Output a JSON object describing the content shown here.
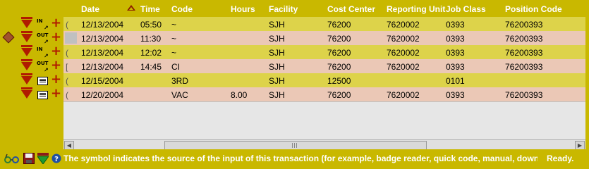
{
  "columns": {
    "date": "Date",
    "time": "Time",
    "code": "Code",
    "hours": "Hours",
    "facility": "Facility",
    "cost_center": "Cost Center",
    "reporting_unit": "Reporting Unit",
    "job_class": "Job Class",
    "position_code": "Position Code"
  },
  "rows": [
    {
      "source_icon": "in-punch-icon",
      "source_label": "IN",
      "prefix": "(",
      "date": "12/13/2004",
      "time": "05:50",
      "code": "~",
      "hours": "",
      "facility": "SJH",
      "cost_center": "76200",
      "reporting_unit": "7620002",
      "job_class": "0393",
      "position_code": "76200393",
      "color": "#ddd34a"
    },
    {
      "source_icon": "out-punch-icon",
      "source_label": "OUT",
      "prefix": "",
      "date": "12/13/2004",
      "time": "11:30",
      "code": "~",
      "hours": "",
      "facility": "SJH",
      "cost_center": "76200",
      "reporting_unit": "7620002",
      "job_class": "0393",
      "position_code": "76200393",
      "color": "#ebc8b6",
      "selected": true
    },
    {
      "source_icon": "in-punch-icon",
      "source_label": "IN",
      "prefix": "(",
      "date": "12/13/2004",
      "time": "12:02",
      "code": "~",
      "hours": "",
      "facility": "SJH",
      "cost_center": "76200",
      "reporting_unit": "7620002",
      "job_class": "0393",
      "position_code": "76200393",
      "color": "#ddd34a"
    },
    {
      "source_icon": "out-punch-icon",
      "source_label": "OUT",
      "prefix": "[",
      "date": "12/13/2004",
      "time": "14:45",
      "code": "CI",
      "hours": "",
      "facility": "SJH",
      "cost_center": "76200",
      "reporting_unit": "7620002",
      "job_class": "0393",
      "position_code": "76200393",
      "color": "#ebc8b6"
    },
    {
      "source_icon": "keyboard-icon",
      "source_label": "",
      "prefix": "(",
      "date": "12/15/2004",
      "time": "",
      "code": "3RD",
      "hours": "",
      "facility": "SJH",
      "cost_center": "12500",
      "reporting_unit": "",
      "job_class": "0101",
      "position_code": "",
      "color": "#ddd34a"
    },
    {
      "source_icon": "calendar-icon",
      "source_label": "",
      "prefix": "(",
      "date": "12/20/2004",
      "time": "",
      "code": "VAC",
      "hours": "8.00",
      "facility": "SJH",
      "cost_center": "76200",
      "reporting_unit": "7620002",
      "job_class": "0393",
      "position_code": "76200393",
      "color": "#ebc8b6"
    }
  ],
  "status": {
    "message": "The symbol indicates the source of the input of this transaction (for example, badge reader, quick code, manual, down...",
    "state": "Ready."
  },
  "icons": {
    "row_marker": "current-row-arrow-icon",
    "delete": "delete-triangle-icon",
    "add": "add-plus-icon",
    "sort": "sort-ascending-icon",
    "status_left": [
      "glasses-icon",
      "save-icon",
      "green-down-arrow-icon",
      "help-icon"
    ]
  },
  "colors": {
    "frame": "#c9b800",
    "row_yellow": "#ddd34a",
    "row_pink": "#ebc8b6",
    "delete_red": "#b01b00"
  }
}
